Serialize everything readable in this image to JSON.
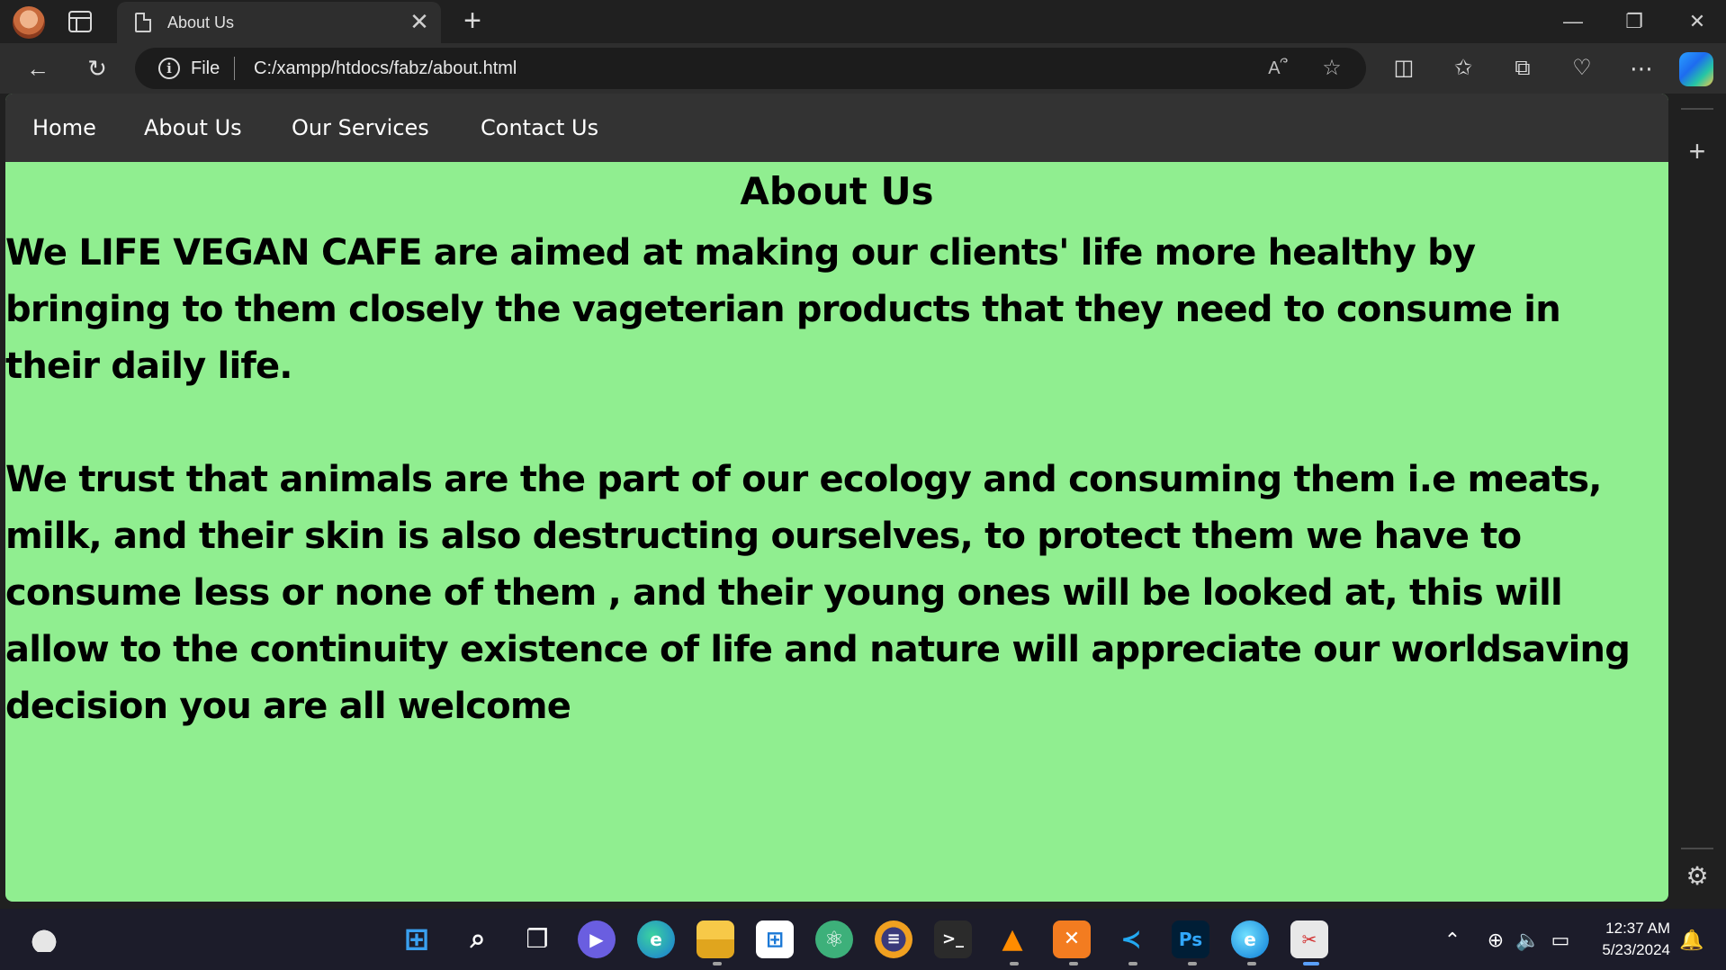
{
  "browser": {
    "tab_title": "About Us",
    "tab_close": "✕",
    "new_tab": "+",
    "window_controls": {
      "minimize": "—",
      "restore": "❐",
      "close": "✕"
    },
    "url_scheme": "File",
    "url": "C:/xampp/htdocs/fabz/about.html",
    "toolbar_icons": [
      "back-icon",
      "refresh-icon",
      "read-aloud-icon",
      "favorite-star-icon",
      "split-screen-icon",
      "favorites-icon",
      "collections-icon",
      "browser-essentials-icon",
      "more-icon",
      "copilot-icon"
    ],
    "sidebar_add": "+",
    "sidebar_gear": "⚙"
  },
  "site": {
    "nav": [
      "Home",
      "About Us",
      "Our Services",
      "Contact Us"
    ],
    "heading": "About Us",
    "paragraph1_lines": [
      "We LIFE VEGAN CAFE are aimed at making our clients' life more healthy by",
      "bringing to them closely the vageterian products that they need to consume in",
      "their daily life."
    ],
    "paragraph2_lines": [
      "We trust that animals are the part of our ecology and consuming them i.e meats,",
      "milk, and their skin is also destructing ourselves, to protect them we have to",
      "consume less or none of them , and their young ones will be looked at, this will",
      "allow to the continuity existence of life and nature will appreciate our worldsaving",
      "decision you are all welcome"
    ],
    "background_color": "#90ee90",
    "nav_color": "#333333"
  },
  "taskbar": {
    "time": "12:37 AM",
    "date": "5/23/2024",
    "apps": [
      "start-icon",
      "search-icon",
      "task-view-icon",
      "teams-icon",
      "edge-icon",
      "file-explorer-icon",
      "store-icon",
      "atom-icon",
      "eclipse-icon",
      "terminal-icon",
      "vlc-icon",
      "xampp-icon",
      "vscode-icon",
      "photoshop-icon",
      "edge-dev-icon",
      "snipping-tool-icon"
    ],
    "photoshop_label": "Ps"
  }
}
